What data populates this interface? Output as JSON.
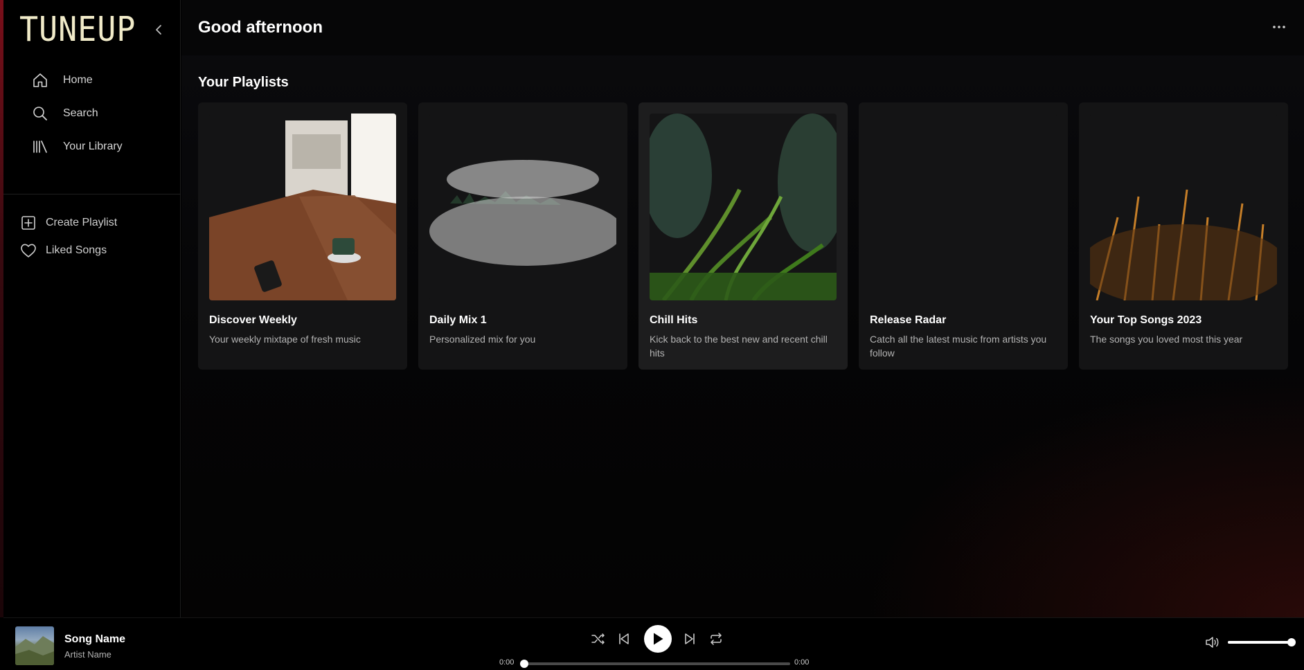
{
  "app": {
    "logo": "TUNEUP"
  },
  "sidebar": {
    "nav": [
      {
        "label": "Home",
        "icon": "home-icon"
      },
      {
        "label": "Search",
        "icon": "search-icon"
      },
      {
        "label": "Your Library",
        "icon": "library-icon"
      }
    ],
    "secondary": [
      {
        "label": "Create Playlist",
        "icon": "plus-square-icon"
      },
      {
        "label": "Liked Songs",
        "icon": "heart-icon"
      }
    ]
  },
  "main": {
    "greeting": "Good afternoon",
    "section_title": "Your Playlists",
    "playlists": [
      {
        "title": "Discover Weekly",
        "description": "Your weekly mixtape of fresh music"
      },
      {
        "title": "Daily Mix 1",
        "description": "Personalized mix for you"
      },
      {
        "title": "Chill Hits",
        "description": "Kick back to the best new and recent chill hits"
      },
      {
        "title": "Release Radar",
        "description": "Catch all the latest music from artists you follow"
      },
      {
        "title": "Your Top Songs 2023",
        "description": "The songs you loved most this year"
      }
    ]
  },
  "player": {
    "song_name": "Song Name",
    "artist_name": "Artist Name",
    "current_time": "0:00",
    "total_time": "0:00",
    "progress": 0,
    "volume": 1
  },
  "colors": {
    "logo": "#f1ebc9",
    "accent_edge": "#7a0f1a"
  }
}
